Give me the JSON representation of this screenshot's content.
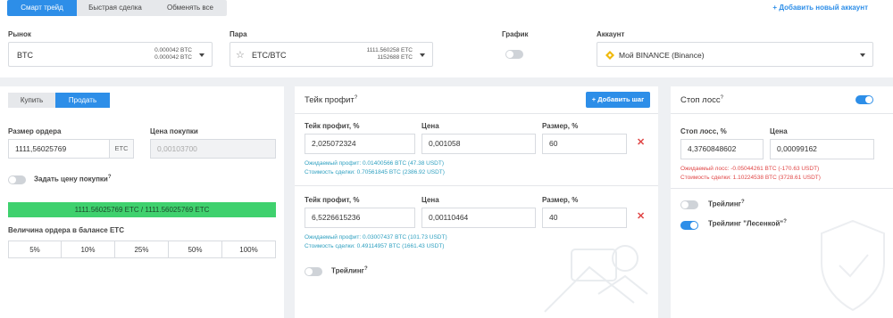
{
  "tabs": [
    "Смарт трейд",
    "Быстрая сделка",
    "Обменять все"
  ],
  "add_account": "+ Добавить новый аккаунт",
  "market": {
    "label": "Рынок",
    "value": "BTC",
    "price1": "0.000042 BTC",
    "price2": "0.000042 BTC"
  },
  "pair": {
    "label": "Пара",
    "value": "ETC/BTC",
    "price1": "1111.560258 ETC",
    "price2": "1152688 ETC"
  },
  "chart": {
    "label": "График"
  },
  "account": {
    "label": "Аккаунт",
    "value": "Мой BINANCE (Binance)"
  },
  "trade": {
    "buy": "Купить",
    "sell": "Продать",
    "order_size_label": "Размер ордера",
    "order_size_value": "1111,56025769",
    "order_size_unit": "ETC",
    "buy_price_label": "Цена покупки",
    "buy_price_placeholder": "0,00103700",
    "set_buy_price": "Задать цену покупки",
    "balance_bar": "1111.56025769 ETC / 1111.56025769 ETC",
    "balance_label": "Величина ордера в балансе ETC",
    "percents": [
      "5%",
      "10%",
      "25%",
      "50%",
      "100%"
    ]
  },
  "take_profit": {
    "title": "Тейк профит",
    "add_step": "+ Добавить шаг",
    "col_tp": "Тейк профит, %",
    "col_price": "Цена",
    "col_size": "Размер, %",
    "rows": [
      {
        "tp": "2,025072324",
        "price": "0,001058",
        "size": "60",
        "profit": "Ожидаемый профит: 0.01400566 BTC (47.38 USDT)",
        "cost": "Стоимость сделки: 0.70561845 BTC (2386.92 USDT)"
      },
      {
        "tp": "6,5226615236",
        "price": "0,00110464",
        "size": "40",
        "profit": "Ожидаемый профит: 0.03007437 BTC (101.73 USDT)",
        "cost": "Стоимость сделки: 0.49114957 BTC (1661.43 USDT)"
      }
    ],
    "trailing": "Трейлинг"
  },
  "stop_loss": {
    "title": "Стоп лосс",
    "col_sl": "Стоп лосс, %",
    "col_price": "Цена",
    "sl_value": "4,3760848602",
    "price_value": "0,00099162",
    "loss": "Ожидаемый лосс: -0.05044261 BTC (-170.63 USDT)",
    "cost": "Стоимость сделки: 1.10224538 BTC (3728.61 USDT)",
    "trailing": "Трейлинг",
    "trailing_ladder": "Трейлинг \"Лесенкой\""
  },
  "colors": {
    "accent": "#2d8ee8",
    "green": "#3fd16e",
    "red": "#e04646",
    "info": "#2fa0c0"
  },
  "icons": [
    "star-icon",
    "binance-icon",
    "caret-down-icon",
    "close-icon"
  ]
}
